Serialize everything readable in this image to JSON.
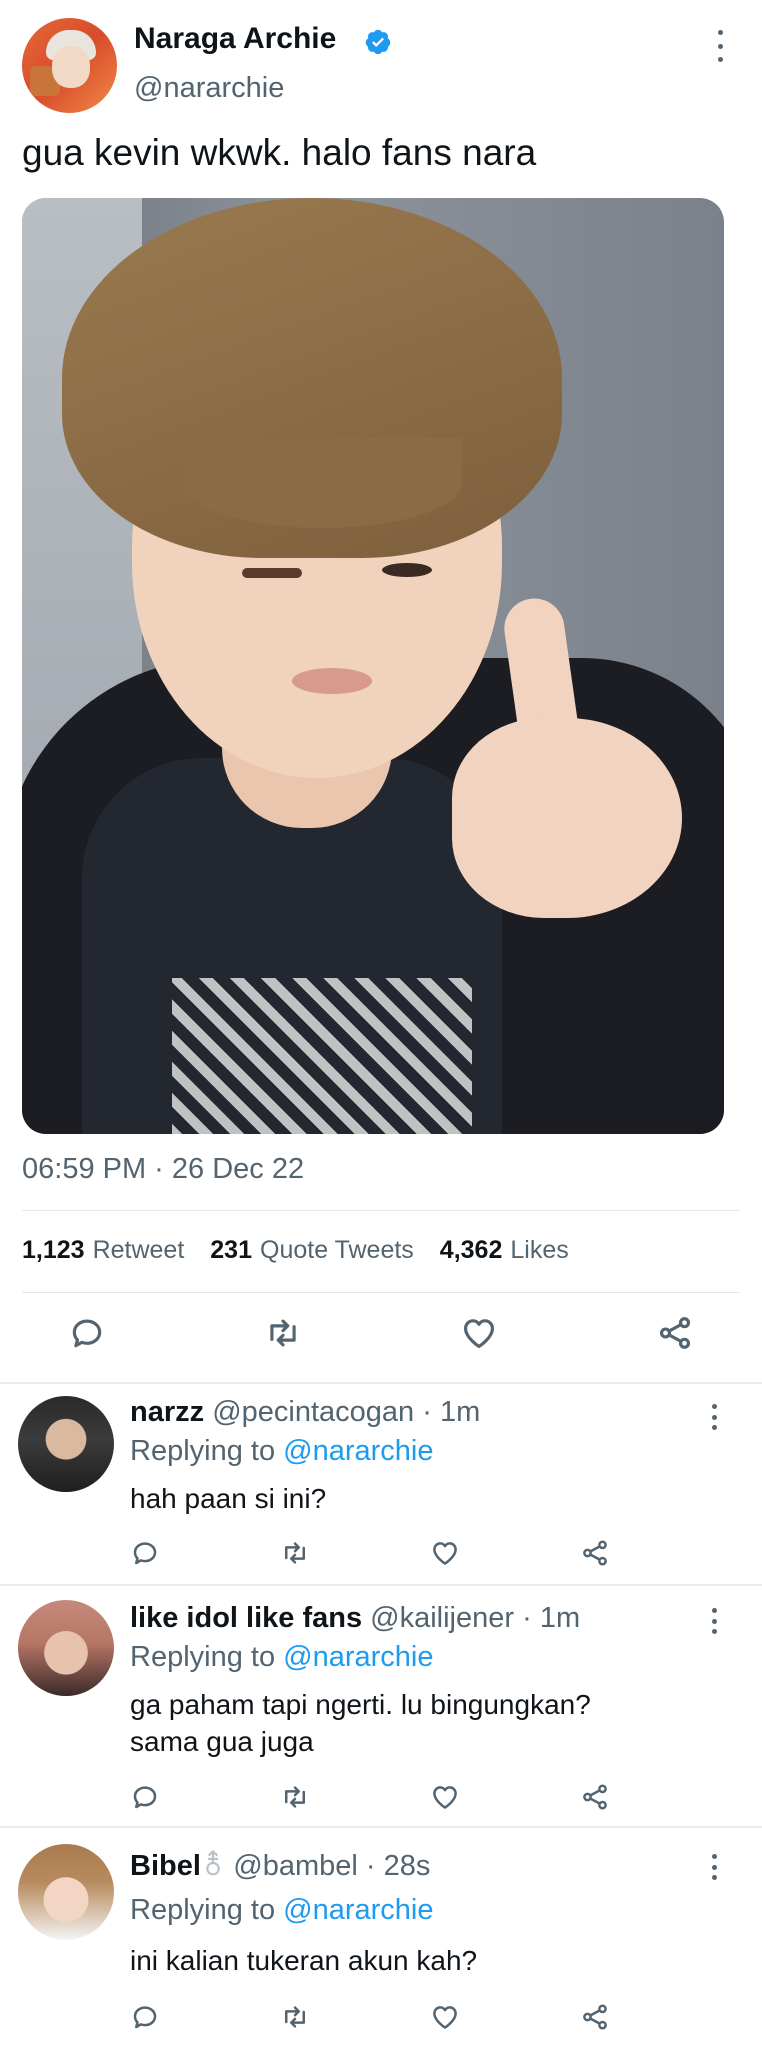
{
  "main_tweet": {
    "display_name": "Naraga Archie",
    "handle": "@nararchie",
    "text": "gua kevin wkwk. halo fans nara",
    "timestamp": "06:59 PM · 26 Dec 22",
    "stats": {
      "retweet_count": "1,123",
      "retweet_label": "Retweet",
      "quote_count": "231",
      "quote_label": "Quote Tweets",
      "likes_count": "4,362",
      "likes_label": "Likes"
    }
  },
  "replies": [
    {
      "name": "narzz",
      "handle": "@pecintacogan",
      "time": "· 1m",
      "replying_prefix": "Replying to",
      "replying_to": "@nararchie",
      "text_lines": [
        "hah paan si ini?"
      ]
    },
    {
      "name": "like idol like fans",
      "handle": "@kailijener",
      "time": "· 1m",
      "replying_prefix": "Replying to",
      "replying_to": "@nararchie",
      "text_lines": [
        "ga paham tapi ngerti. lu bingungkan?",
        "sama gua juga"
      ]
    },
    {
      "name": "Bibel",
      "handle": "@bambel",
      "time": "· 28s",
      "replying_prefix": "Replying to",
      "replying_to": "@nararchie",
      "text_lines": [
        "ini kalian tukeran akun kah?"
      ]
    }
  ],
  "colors": {
    "link": "#1d9bf0",
    "verified": "#1d9bf0",
    "muted_text": "#536471",
    "divider": "#e6ecf0"
  },
  "icons": {
    "reply": "reply-icon",
    "retweet": "retweet-icon",
    "like": "heart-icon",
    "share": "share-icon",
    "more": "more-icon",
    "verified": "verified-badge-icon"
  }
}
